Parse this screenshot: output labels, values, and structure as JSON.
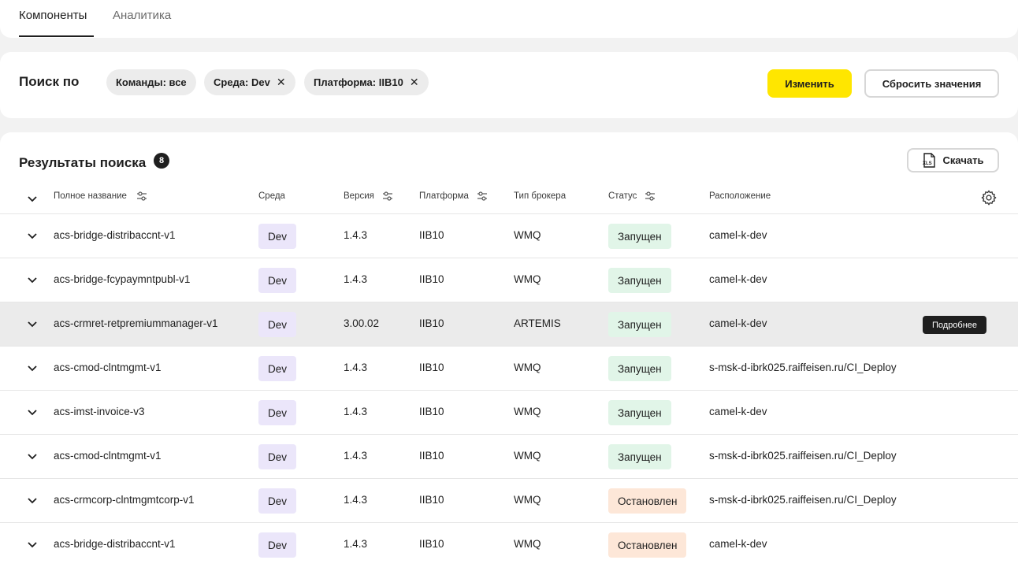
{
  "tabs": {
    "components": "Компоненты",
    "analytics": "Аналитика"
  },
  "search": {
    "title": "Поиск по",
    "chips": {
      "teams": "Команды: все",
      "env": "Среда: Dev",
      "platform": "Платформа: IIB10"
    },
    "change_label": "Изменить",
    "reset_label": "Сбросить значения"
  },
  "results": {
    "title": "Результаты поиска",
    "count": "8",
    "download_label": "Скачать",
    "columns": {
      "name": "Полное название",
      "env": "Среда",
      "version": "Версия",
      "platform": "Платформа",
      "broker": "Тип брокера",
      "status": "Статус",
      "location": "Расположение"
    },
    "more_label": "Подробнее",
    "rows": [
      {
        "name": "acs-bridge-distribaccnt-v1",
        "env": "Dev",
        "version": "1.4.3",
        "platform": "IIB10",
        "broker": "WMQ",
        "status": "Запущен",
        "location": "camel-k-dev"
      },
      {
        "name": "acs-bridge-fcypaymntpubl-v1",
        "env": "Dev",
        "version": "1.4.3",
        "platform": "IIB10",
        "broker": "WMQ",
        "status": "Запущен",
        "location": "camel-k-dev"
      },
      {
        "name": "acs-crmret-retpremiummanager-v1",
        "env": "Dev",
        "version": "3.00.02",
        "platform": "IIB10",
        "broker": "ARTEMIS",
        "status": "Запущен",
        "location": "camel-k-dev"
      },
      {
        "name": "acs-cmod-clntmgmt-v1",
        "env": "Dev",
        "version": "1.4.3",
        "platform": "IIB10",
        "broker": "WMQ",
        "status": "Запущен",
        "location": "s-msk-d-ibrk025.raiffeisen.ru/CI_Deploy"
      },
      {
        "name": "acs-imst-invoice-v3",
        "env": "Dev",
        "version": "1.4.3",
        "platform": "IIB10",
        "broker": "WMQ",
        "status": "Запущен",
        "location": "camel-k-dev"
      },
      {
        "name": "acs-cmod-clntmgmt-v1",
        "env": "Dev",
        "version": "1.4.3",
        "platform": "IIB10",
        "broker": "WMQ",
        "status": "Запущен",
        "location": "s-msk-d-ibrk025.raiffeisen.ru/CI_Deploy"
      },
      {
        "name": "acs-crmcorp-clntmgmtcorp-v1",
        "env": "Dev",
        "version": "1.4.3",
        "platform": "IIB10",
        "broker": "WMQ",
        "status": "Остановлен",
        "location": "s-msk-d-ibrk025.raiffeisen.ru/CI_Deploy"
      },
      {
        "name": "acs-bridge-distribaccnt-v1",
        "env": "Dev",
        "version": "1.4.3",
        "platform": "IIB10",
        "broker": "WMQ",
        "status": "Остановлен",
        "location": "camel-k-dev"
      }
    ]
  },
  "colors": {
    "accent": "#ffe600",
    "env_badge": "#ebe6fa",
    "status_running": "#e1f5e8",
    "status_stopped": "#fde7d8",
    "row_highlight": "#ebebeb"
  }
}
